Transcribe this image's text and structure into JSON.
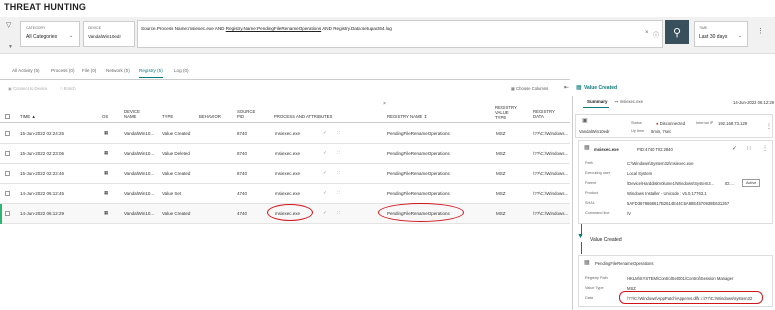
{
  "page_title": "THREAT HUNTING",
  "filters": {
    "category_label": "CATEGORY",
    "category_value": "All Categories",
    "device_label": "DEVICE",
    "device_value": "VandalWin10edr",
    "query_prefix": "Source.Process Name:msiexec.exe AND",
    "query_link": "Registry.Name:PendingFileRenameOperations",
    "query_suffix": "AND Registry.Data:setupact64.log",
    "time_label": "TIME",
    "time_value": "Last 30 days"
  },
  "tabs": [
    {
      "label": "All Activity (5)"
    },
    {
      "label": "Process (0)"
    },
    {
      "label": "File (0)"
    },
    {
      "label": "Network (0)"
    },
    {
      "label": "Registry (5)"
    },
    {
      "label": "Log (0)"
    }
  ],
  "toolbar": {
    "connect_label": "Connect to Device",
    "enrich_label": "Enrich",
    "choose_columns": "Choose Columns"
  },
  "columns": {
    "time": "TIME",
    "os": "OS",
    "device_name": "DEVICE NAME",
    "type": "TYPE",
    "behavior": "BEHAVIOR",
    "source_pid": "SOURCE PID",
    "process": "PROCESS AND ATTRIBUTES",
    "registry_name": "REGISTRY NAME",
    "registry_value_type": "REGISTRY VALUE TYPE",
    "registry_data": "REGISTRY DATA"
  },
  "rows": [
    {
      "time": "15-Jun-2022 02:24:25",
      "device": "VandalWin10...",
      "type": "Value Created",
      "pid": "8740",
      "process": "msiexec.exe",
      "reg_name": "PendingFileRenameOperations",
      "vtype": "MSZ",
      "data": "\\??\\C:\\Windows..."
    },
    {
      "time": "15-Jun-2022 02:23:06",
      "device": "VandalWin10...",
      "type": "Value Deleted",
      "pid": "8740",
      "process": "msiexec.exe",
      "reg_name": "PendingFileRenameOperations",
      "vtype": "MSZ",
      "data": "\\??\\C:\\Windows..."
    },
    {
      "time": "15-Jun-2022 02:22:46",
      "device": "VandalWin10...",
      "type": "Value Created",
      "pid": "8740",
      "process": "msiexec.exe",
      "reg_name": "PendingFileRenameOperations",
      "vtype": "MSZ",
      "data": "\\??\\C:\\Windows..."
    },
    {
      "time": "14-Jun-2022 06:12:45",
      "device": "VandalWin10...",
      "type": "Value Set",
      "pid": "4740",
      "process": "msiexec.exe",
      "reg_name": "PendingFileRenameOperations",
      "vtype": "MSZ",
      "data": "\\??\\C:\\Windows..."
    },
    {
      "time": "14-Jun-2022 06:12:29",
      "device": "VandalWin10...",
      "type": "Value Created",
      "pid": "4740",
      "process": "msiexec.exe",
      "reg_name": "PendingFileRenameOperations",
      "vtype": "MSZ",
      "data": "\\??\\C:\\Windows..."
    }
  ],
  "panel": {
    "title": "Value Created",
    "tab_summary": "Summary",
    "tab_process": "msiexec.exe",
    "timestamp": "14-Jun-2022 06:12:29",
    "device_name": "VandalWin10edr",
    "status_label": "Status",
    "status_value": "Disconnected",
    "uptime_label": "Up time",
    "uptime_value": "5min, 7sec",
    "ip_label": "Internal IP",
    "ip_value": "192.168.73.129",
    "process_name": "msiexec.exe",
    "pid_text": "PID:4740   TID:2840",
    "path_label": "Path",
    "path_value": "C:\\Windows\\System32\\msiexec.exe",
    "user_label": "Executing user",
    "user_value": "Local System",
    "parent_label": "Parent",
    "parent_value": "\\Device\\HarddiskVolume1\\Windows\\System3...",
    "parent_id": "ID:...",
    "active_label": "Active",
    "product_label": "Product",
    "product_value": "Windows Installer - Unicode : v5.0.17763.1",
    "sha_label": "SHA1",
    "sha_value": "5AFD3678668617B2614E44C6A88E4570938E631267",
    "cmd_label": "Command line",
    "cmd_value": "/V",
    "event_title": "Value Created",
    "reg_card_title": "PendingFileRenameOperations",
    "reg_path_label": "Registry Path",
    "reg_path_value": "HKLM\\SYSTEM\\ControlSet001\\Control\\Session Manager",
    "vtype_label": "Value Type",
    "vtype_value": "MSZ",
    "data_label": "Data",
    "data_value": "\\??\\C:\\Windows\\AppPatch\\Appems.dll\\□□\\??\\C:\\Windows\\system32"
  },
  "colors": {
    "accent": "#0c7a7a",
    "search_button": "#38505c",
    "highlight_oval": "#d0161d",
    "status_disconnected": "#c0392b"
  }
}
